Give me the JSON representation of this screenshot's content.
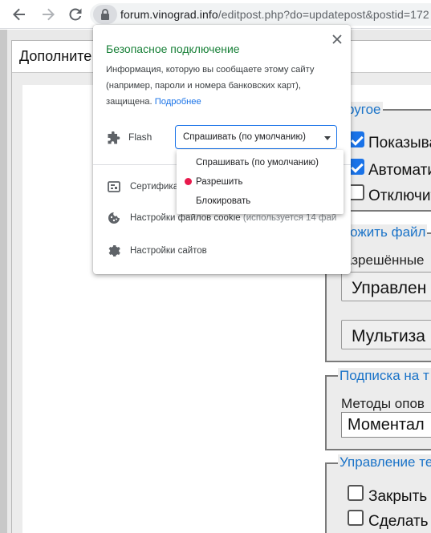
{
  "browser": {
    "url_host": "forum.vinograd.info",
    "url_path": "/editpost.php?do=updatepost&postid=172",
    "icons": {
      "back": "arrow-left-icon",
      "forward": "arrow-right-icon",
      "reload": "reload-icon",
      "lock": "lock-icon"
    }
  },
  "background_page": {
    "window_title": "Дополните",
    "group1": {
      "legend": "ругое",
      "options": [
        {
          "label": "Показыва",
          "checked": true
        },
        {
          "label": "Автомати",
          "checked": true
        },
        {
          "label": "Отключит",
          "checked": false
        }
      ]
    },
    "group2": {
      "legend": "ложить файл",
      "label": "азрешённые",
      "buttons": [
        "Управлен",
        "Мультиза"
      ]
    },
    "group3": {
      "legend": "Подписка на т",
      "label": "Методы опов",
      "select_value": "Моментал"
    },
    "group4": {
      "legend": "Управление те",
      "options": [
        {
          "label": "Закрыть з",
          "checked": false
        },
        {
          "label": "Сделать т",
          "checked": false
        }
      ]
    }
  },
  "popup": {
    "title": "Безопасное подключение",
    "description": "Информация, которую вы сообщаете этому сайту (например, пароли и номера банковских карт), защищена.",
    "more_link": "Подробнее",
    "flash": {
      "label": "Flash",
      "icon": "puzzle-icon",
      "selected": "Спрашивать (по умолчанию)"
    },
    "rows": [
      {
        "label": "Сертифика",
        "icon": "certificate-icon"
      },
      {
        "label": "Настройки файлов cookie",
        "sub": "(используется 14 фай",
        "icon": "cookie-icon"
      },
      {
        "label": "Настройки сайтов",
        "icon": "gear-icon"
      }
    ],
    "dropdown_options": [
      {
        "label": "Спрашивать (по умолчанию)",
        "marked": false
      },
      {
        "label": "Разрешить",
        "marked": true
      },
      {
        "label": "Блокировать",
        "marked": false
      }
    ],
    "colors": {
      "title": "#188038",
      "link": "#1a73e8",
      "marker": "#e8194c"
    }
  }
}
